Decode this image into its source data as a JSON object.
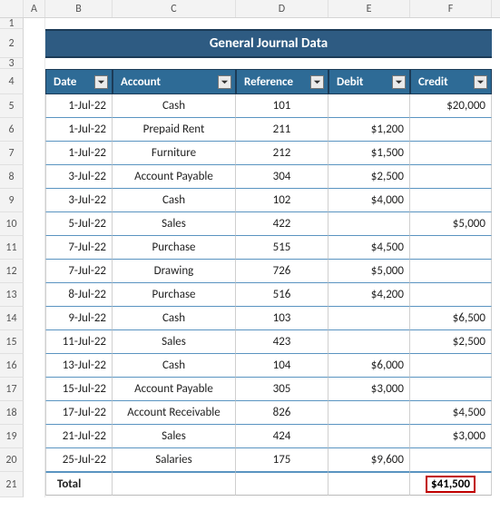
{
  "columns": [
    "A",
    "B",
    "C",
    "D",
    "E",
    "F"
  ],
  "row_numbers": [
    "1",
    "2",
    "3",
    "4",
    "5",
    "6",
    "7",
    "8",
    "9",
    "10",
    "11",
    "12",
    "13",
    "14",
    "15",
    "16",
    "17",
    "18",
    "19",
    "20",
    "21"
  ],
  "title": "General Journal Data",
  "headers": {
    "date": "Date",
    "account": "Account",
    "reference": "Reference",
    "debit": "Debit",
    "credit": "Credit"
  },
  "rows": [
    {
      "date": "1-Jul-22",
      "account": "Cash",
      "reference": "101",
      "debit": "",
      "credit": "$20,000"
    },
    {
      "date": "1-Jul-22",
      "account": "Prepaid Rent",
      "reference": "211",
      "debit": "$1,200",
      "credit": ""
    },
    {
      "date": "1-Jul-22",
      "account": "Furniture",
      "reference": "212",
      "debit": "$1,500",
      "credit": ""
    },
    {
      "date": "3-Jul-22",
      "account": "Account Payable",
      "reference": "304",
      "debit": "$2,500",
      "credit": ""
    },
    {
      "date": "3-Jul-22",
      "account": "Cash",
      "reference": "102",
      "debit": "$4,000",
      "credit": ""
    },
    {
      "date": "5-Jul-22",
      "account": "Sales",
      "reference": "422",
      "debit": "",
      "credit": "$5,000"
    },
    {
      "date": "7-Jul-22",
      "account": "Purchase",
      "reference": "515",
      "debit": "$4,500",
      "credit": ""
    },
    {
      "date": "7-Jul-22",
      "account": "Drawing",
      "reference": "726",
      "debit": "$5,000",
      "credit": ""
    },
    {
      "date": "8-Jul-22",
      "account": "Purchase",
      "reference": "516",
      "debit": "$4,200",
      "credit": ""
    },
    {
      "date": "9-Jul-22",
      "account": "Cash",
      "reference": "103",
      "debit": "",
      "credit": "$6,500"
    },
    {
      "date": "11-Jul-22",
      "account": "Sales",
      "reference": "423",
      "debit": "",
      "credit": "$2,500"
    },
    {
      "date": "13-Jul-22",
      "account": "Cash",
      "reference": "104",
      "debit": "$6,000",
      "credit": ""
    },
    {
      "date": "15-Jul-22",
      "account": "Account Payable",
      "reference": "305",
      "debit": "$3,000",
      "credit": ""
    },
    {
      "date": "17-Jul-22",
      "account": "Account Receivable",
      "reference": "826",
      "debit": "",
      "credit": "$4,500"
    },
    {
      "date": "21-Jul-22",
      "account": "Sales",
      "reference": "424",
      "debit": "",
      "credit": "$3,000"
    },
    {
      "date": "25-Jul-22",
      "account": "Salaries",
      "reference": "175",
      "debit": "$9,600",
      "credit": ""
    }
  ],
  "total": {
    "label": "Total",
    "value": "$41,500"
  },
  "chart_data": {
    "type": "table",
    "title": "General Journal Data",
    "columns": [
      "Date",
      "Account",
      "Reference",
      "Debit",
      "Credit"
    ],
    "data": [
      [
        "1-Jul-22",
        "Cash",
        101,
        null,
        20000
      ],
      [
        "1-Jul-22",
        "Prepaid Rent",
        211,
        1200,
        null
      ],
      [
        "1-Jul-22",
        "Furniture",
        212,
        1500,
        null
      ],
      [
        "3-Jul-22",
        "Account Payable",
        304,
        2500,
        null
      ],
      [
        "3-Jul-22",
        "Cash",
        102,
        4000,
        null
      ],
      [
        "5-Jul-22",
        "Sales",
        422,
        null,
        5000
      ],
      [
        "7-Jul-22",
        "Purchase",
        515,
        4500,
        null
      ],
      [
        "7-Jul-22",
        "Drawing",
        726,
        5000,
        null
      ],
      [
        "8-Jul-22",
        "Purchase",
        516,
        4200,
        null
      ],
      [
        "9-Jul-22",
        "Cash",
        103,
        null,
        6500
      ],
      [
        "11-Jul-22",
        "Sales",
        423,
        null,
        2500
      ],
      [
        "13-Jul-22",
        "Cash",
        104,
        6000,
        null
      ],
      [
        "15-Jul-22",
        "Account Payable",
        305,
        3000,
        null
      ],
      [
        "17-Jul-22",
        "Account Receivable",
        826,
        null,
        4500
      ],
      [
        "21-Jul-22",
        "Sales",
        424,
        null,
        3000
      ],
      [
        "25-Jul-22",
        "Salaries",
        175,
        9600,
        null
      ]
    ],
    "total_credit": 41500
  }
}
